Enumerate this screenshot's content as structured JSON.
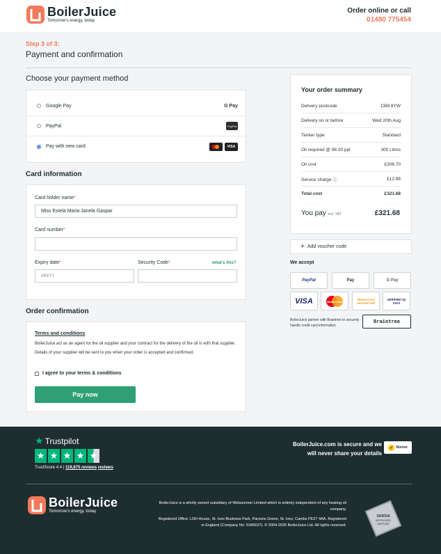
{
  "header": {
    "logo_name": "BoilerJuice",
    "logo_tagline": "Tomorrow's energy, today",
    "order_online": "Order online or call",
    "phone": "01480 775454"
  },
  "step": {
    "label": "Step 3 of 3:",
    "title": "Payment and confirmation"
  },
  "payment": {
    "title": "Choose your payment method",
    "methods": [
      {
        "label": "Google Pay",
        "badge": "G Pay",
        "selected": false
      },
      {
        "label": "PayPal",
        "badge": "PayPal",
        "selected": false
      },
      {
        "label": "Pay with new card",
        "badge": "VISA",
        "selected": true
      }
    ]
  },
  "card_info": {
    "title": "Card information",
    "holder_label": "Card holder name",
    "holder_value": "Miss Estela Maria Janela Gaspar",
    "number_label": "Card number",
    "expiry_label": "Expiry date",
    "expiry_placeholder": "MM/YY",
    "security_label": "Security Code",
    "whats_this": "what's this?"
  },
  "order_confirmation": {
    "title": "Order confirmation",
    "terms_title": "Terms and conditions",
    "terms_text": "BoilerJuice act as an agent for the oil supplier and your contract for the delivery of the oil is with that supplier. Details of your supplier will be sent to you when your order is accepted and confirmed.",
    "agree_label": "I agree to your terms & conditions",
    "pay_button": "Pay now"
  },
  "summary": {
    "title": "Your order summary",
    "rows": [
      {
        "label": "Delivery postcode",
        "value": "CB8 8YW"
      },
      {
        "label": "Delivery on or before",
        "value": "Wed 20th Aug"
      },
      {
        "label": "Tanker type",
        "value": "Standard"
      },
      {
        "label": "Oil required @ 98.00 ppl",
        "value": "300 Litres"
      },
      {
        "label": "Oil cost",
        "value": "£308.70"
      },
      {
        "label": "Service charge ⓘ",
        "value": "£12.98"
      },
      {
        "label": "Total cost",
        "value": "£321.68"
      }
    ],
    "you_pay_label": "You pay",
    "you_pay_suffix": "incl. VAT",
    "you_pay_value": "£321.68"
  },
  "voucher": {
    "label": "Add voucher code"
  },
  "accept": {
    "title": "We accept",
    "logos": [
      "PayPal",
      "Pay",
      "G Pay",
      "VISA",
      "MasterCard",
      "MasterCard SecureCode",
      "VERIFIED by VISA"
    ]
  },
  "braintree": {
    "text": "BoilerJuice partner with Braintree to securely handle credit card information",
    "logo": "Braintree"
  },
  "footer": {
    "trustpilot": "Trustpilot",
    "trustscore_label": "TrustScore 4.4",
    "reviews": "119,875 reviews",
    "secure_text": "BoilerJuice.com is secure and we will never share your details",
    "norton": "Norton",
    "subsidiary": "BoilerJuice is a wholly owned subsidiary of Welsummer Limited which is entirely independent of any heating oil company.",
    "registered": "Registered Office: LDH House, St. Ives Business Park, Parsons Green, St. Ives, Cambs PE27 4AA. Registered in England (Company No: 5345637). © 2004-2025 BoilerJuice Ltd. All rights reserved.",
    "ukifda": "UKIFDA APPROVED SUPPLIER"
  },
  "colors": {
    "accent": "#f07a5a",
    "button": "#2e9f76",
    "footer_bg": "#1e2d2f",
    "trustpilot": "#00b67a"
  }
}
